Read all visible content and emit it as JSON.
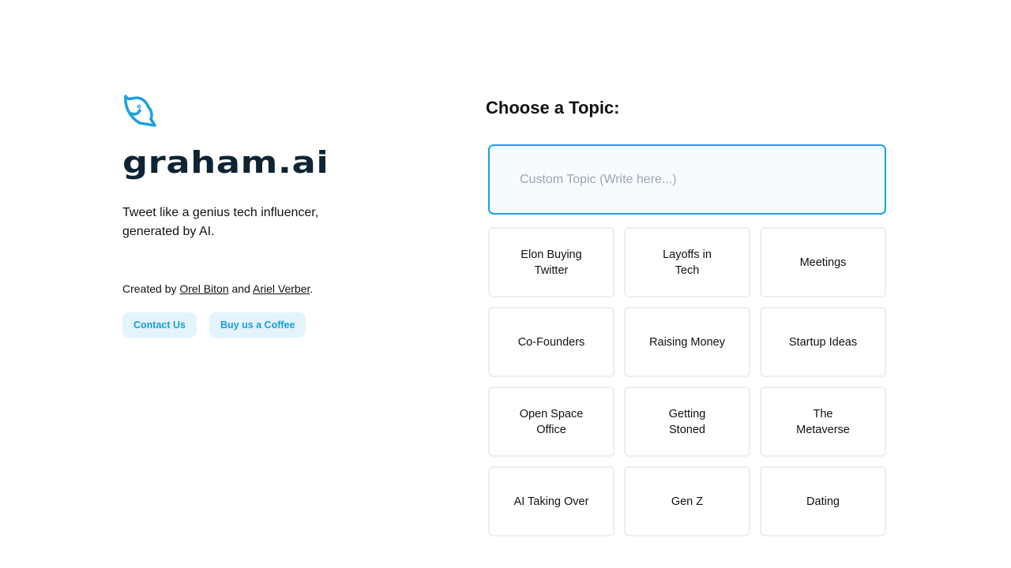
{
  "brand": {
    "name": "graham.ai",
    "icon": "bird-logo-icon",
    "accent_color": "#1DA1E2",
    "brand_text_color": "#0E2433"
  },
  "intro": {
    "tagline": "Tweet like a genius tech influencer, generated by AI."
  },
  "credits": {
    "prefix": "Created by",
    "author1": "Orel Biton",
    "conjunction": "and",
    "author2": "Ariel Verber",
    "suffix": "."
  },
  "buttons": {
    "contact": "Contact Us",
    "coffee": "Buy us a Coffee"
  },
  "topics_section": {
    "title": "Choose a Topic:",
    "custom_placeholder": "Custom Topic (Write here...)",
    "custom_value": "",
    "topics": [
      {
        "label": "Elon Buying Twitter"
      },
      {
        "label": "Layoffs in Tech"
      },
      {
        "label": "Meetings"
      },
      {
        "label": "Co-Founders"
      },
      {
        "label": "Raising Money"
      },
      {
        "label": "Startup Ideas"
      },
      {
        "label": "Open Space Office"
      },
      {
        "label": "Getting Stoned"
      },
      {
        "label": "The Metaverse"
      },
      {
        "label": "AI Taking Over"
      },
      {
        "label": "Gen Z"
      },
      {
        "label": "Dating"
      }
    ]
  }
}
